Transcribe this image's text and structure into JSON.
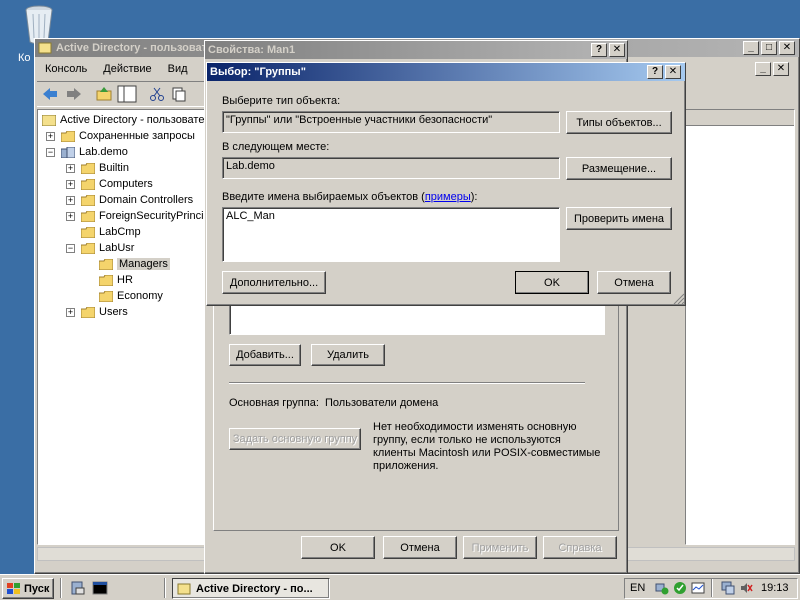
{
  "desktop": {
    "recycle_bin_label": "Ко"
  },
  "mmc": {
    "title": "Active Directory - пользовате...",
    "menu": [
      "Консоль",
      "Действие",
      "Вид"
    ],
    "tree": {
      "root": "Active Directory - пользовате",
      "saved_queries": "Сохраненные запросы",
      "domain": "Lab.demo",
      "children": [
        "Builtin",
        "Computers",
        "Domain Controllers",
        "ForeignSecurityPrincip",
        "LabCmp",
        "LabUsr"
      ],
      "labusr_children": [
        "Managers",
        "HR",
        "Economy"
      ],
      "users": "Users"
    }
  },
  "props": {
    "title": "Свойства: Man1",
    "add_button": "Добавить...",
    "remove_button": "Удалить",
    "primary_group_label": "Основная группа:",
    "primary_group_value": "Пользователи домена",
    "set_primary_button": "Задать основную группу",
    "note": [
      "Нет необходимости изменять основную",
      "группу, если только не используются",
      "клиенты Macintosh или POSIX-совместимые",
      "приложения."
    ],
    "ok": "OK",
    "cancel": "Отмена",
    "apply": "Применить",
    "help": "Справка"
  },
  "dialog": {
    "title": "Выбор: \"Группы\"",
    "object_type_label": "Выберите тип объекта:",
    "object_type_value": "\"Группы\" или \"Встроенные участники безопасности\"",
    "object_types_button": "Типы объектов...",
    "location_label": "В следующем месте:",
    "location_value": "Lab.demo",
    "location_button": "Размещение...",
    "names_label_prefix": "Введите имена выбираемых объектов (",
    "names_label_link": "примеры",
    "names_label_suffix": "):",
    "names_value": "ALC_Man",
    "check_names_button": "Проверить имена",
    "advanced_button": "Дополнительно...",
    "ok": "OK",
    "cancel": "Отмена"
  },
  "taskbar": {
    "start": "Пуск",
    "task": "Active Directory - по...",
    "lang": "EN",
    "clock": "19:13"
  }
}
